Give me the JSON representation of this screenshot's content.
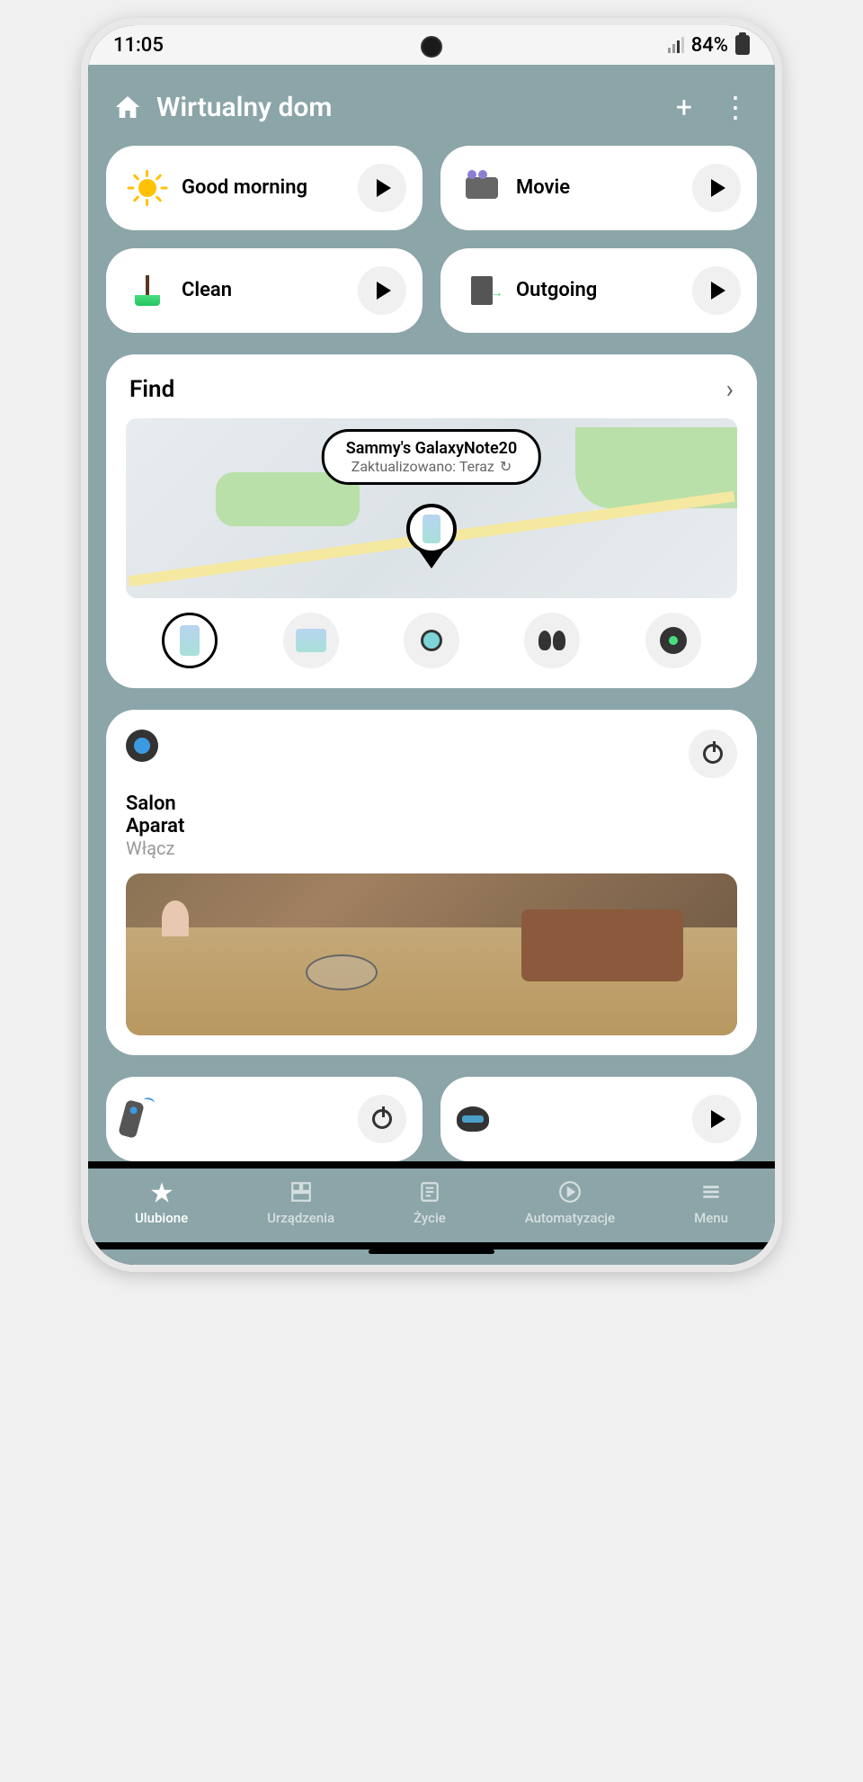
{
  "status": {
    "time": "11:05",
    "battery": "84%"
  },
  "header": {
    "title": "Wirtualny dom"
  },
  "scenes": [
    {
      "label": "Good morning",
      "icon": "sun"
    },
    {
      "label": "Movie",
      "icon": "camera"
    },
    {
      "label": "Clean",
      "icon": "broom"
    },
    {
      "label": "Outgoing",
      "icon": "door"
    }
  ],
  "find": {
    "title": "Find",
    "device_name": "Sammy's GalaxyNote20",
    "updated": "Zaktualizowano: Teraz"
  },
  "camera": {
    "room": "Salon",
    "name": "Aparat",
    "status": "Włącz"
  },
  "nav": [
    {
      "label": "Ulubione",
      "active": true
    },
    {
      "label": "Urządzenia",
      "active": false
    },
    {
      "label": "Życie",
      "active": false
    },
    {
      "label": "Automatyzacje",
      "active": false
    },
    {
      "label": "Menu",
      "active": false
    }
  ]
}
